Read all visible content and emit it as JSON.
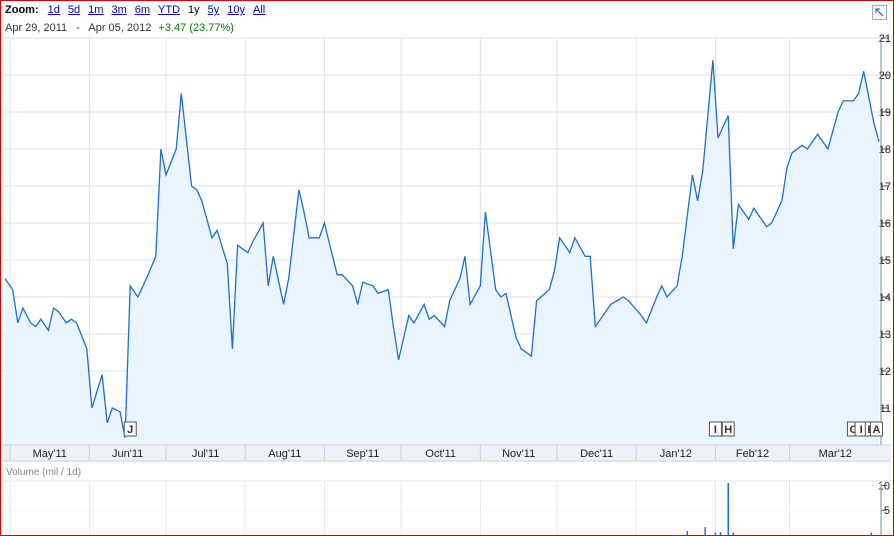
{
  "zoom": {
    "label": "Zoom:",
    "options": [
      "1d",
      "5d",
      "1m",
      "3m",
      "6m",
      "YTD",
      "1y",
      "5y",
      "10y",
      "All"
    ],
    "active": "1y"
  },
  "range": {
    "start": "Apr 29, 2011",
    "separator": "-",
    "end": "Apr 05, 2012",
    "change": "+3.47 (23.77%)"
  },
  "volume_label": "Volume (mil / 1d)",
  "colors": {
    "line": "#1c6fd1",
    "fill": "#e9f4fd",
    "grid": "#dde3ea",
    "change": "#008000",
    "frame": "#d40000"
  },
  "chart_data": [
    {
      "type": "area",
      "x": [
        "2011-04-29",
        "2011-05-02",
        "2011-05-04",
        "2011-05-06",
        "2011-05-09",
        "2011-05-11",
        "2011-05-13",
        "2011-05-16",
        "2011-05-18",
        "2011-05-20",
        "2011-05-23",
        "2011-05-25",
        "2011-05-27",
        "2011-05-31",
        "2011-06-02",
        "2011-06-06",
        "2011-06-08",
        "2011-06-10",
        "2011-06-13",
        "2011-06-15",
        "2011-06-17",
        "2011-06-20",
        "2011-06-22",
        "2011-06-24",
        "2011-06-27",
        "2011-06-29",
        "2011-07-01",
        "2011-07-05",
        "2011-07-07",
        "2011-07-11",
        "2011-07-13",
        "2011-07-15",
        "2011-07-19",
        "2011-07-21",
        "2011-07-25",
        "2011-07-27",
        "2011-07-29",
        "2011-08-02",
        "2011-08-04",
        "2011-08-08",
        "2011-08-10",
        "2011-08-12",
        "2011-08-16",
        "2011-08-18",
        "2011-08-22",
        "2011-08-24",
        "2011-08-26",
        "2011-08-30",
        "2011-09-01",
        "2011-09-06",
        "2011-09-08",
        "2011-09-12",
        "2011-09-14",
        "2011-09-16",
        "2011-09-20",
        "2011-09-22",
        "2011-09-26",
        "2011-09-28",
        "2011-09-30",
        "2011-10-04",
        "2011-10-06",
        "2011-10-10",
        "2011-10-12",
        "2011-10-14",
        "2011-10-18",
        "2011-10-20",
        "2011-10-24",
        "2011-10-26",
        "2011-10-28",
        "2011-11-01",
        "2011-11-03",
        "2011-11-07",
        "2011-11-09",
        "2011-11-11",
        "2011-11-15",
        "2011-11-17",
        "2011-11-21",
        "2011-11-23",
        "2011-11-28",
        "2011-11-30",
        "2011-12-02",
        "2011-12-06",
        "2011-12-08",
        "2011-12-12",
        "2011-12-14",
        "2011-12-16",
        "2011-12-20",
        "2011-12-22",
        "2011-12-27",
        "2011-12-29",
        "2012-01-03",
        "2012-01-05",
        "2012-01-09",
        "2012-01-11",
        "2012-01-13",
        "2012-01-17",
        "2012-01-19",
        "2012-01-23",
        "2012-01-25",
        "2012-01-27",
        "2012-01-31",
        "2012-02-02",
        "2012-02-06",
        "2012-02-08",
        "2012-02-10",
        "2012-02-14",
        "2012-02-16",
        "2012-02-21",
        "2012-02-23",
        "2012-02-27",
        "2012-02-29",
        "2012-03-02",
        "2012-03-06",
        "2012-03-08",
        "2012-03-12",
        "2012-03-14",
        "2012-03-16",
        "2012-03-20",
        "2012-03-22",
        "2012-03-26",
        "2012-03-28",
        "2012-03-30",
        "2012-04-03",
        "2012-04-05"
      ],
      "series": [
        {
          "values": [
            14.5,
            14.2,
            13.3,
            13.7,
            13.3,
            13.2,
            13.4,
            13.1,
            13.7,
            13.6,
            13.3,
            13.4,
            13.3,
            12.6,
            11.0,
            11.9,
            10.6,
            11.0,
            10.9,
            10.2,
            14.3,
            14.0,
            14.3,
            14.6,
            15.1,
            18.0,
            17.3,
            18.0,
            19.5,
            17.0,
            16.9,
            16.6,
            15.6,
            15.8,
            14.9,
            12.6,
            15.4,
            15.2,
            15.5,
            16.0,
            14.3,
            15.1,
            13.8,
            14.5,
            16.9,
            16.3,
            15.6,
            15.6,
            16.0,
            14.6,
            14.6,
            14.3,
            13.8,
            14.4,
            14.3,
            14.1,
            14.2,
            13.2,
            12.3,
            13.5,
            13.3,
            13.8,
            13.4,
            13.5,
            13.2,
            13.9,
            14.5,
            15.1,
            13.8,
            14.3,
            16.3,
            14.2,
            14.0,
            14.1,
            12.9,
            12.6,
            12.4,
            13.9,
            14.2,
            14.7,
            15.6,
            15.2,
            15.6,
            15.1,
            15.1,
            13.2,
            13.6,
            13.8,
            14.0,
            13.9,
            13.5,
            13.3,
            14.0,
            14.3,
            14.0,
            14.3,
            15.1,
            17.3,
            16.6,
            17.4,
            20.4,
            18.3,
            18.9,
            15.3,
            16.5,
            16.1,
            16.4,
            15.9,
            16.0,
            16.6,
            17.5,
            17.9,
            18.1,
            18.0,
            18.4,
            18.2,
            18.0,
            19.0,
            19.3,
            19.3,
            19.5,
            20.1,
            18.7,
            18.2
          ]
        }
      ],
      "y_ticks": [
        "11",
        "12",
        "13",
        "14",
        "15",
        "16",
        "17",
        "18",
        "19",
        "20",
        "21"
      ],
      "ylim": [
        10.0,
        21.0
      ],
      "x_tick_labels": [
        "May'11",
        "Jun'11",
        "Jul'11",
        "Aug'11",
        "Sep'11",
        "Oct'11",
        "Nov'11",
        "Dec'11",
        "Jan'12",
        "Feb'12",
        "Mar'12"
      ],
      "x_tick_dates": [
        "2011-05-01",
        "2011-06-01",
        "2011-07-01",
        "2011-08-01",
        "2011-09-01",
        "2011-10-01",
        "2011-11-01",
        "2011-12-01",
        "2012-01-01",
        "2012-02-01",
        "2012-03-01"
      ],
      "grid": true,
      "annotations": [
        {
          "label": "J",
          "date": "2011-06-17"
        },
        {
          "label": "I",
          "date": "2012-02-01"
        },
        {
          "label": "H",
          "date": "2012-02-06"
        },
        {
          "label": "C",
          "date": "2012-03-26"
        },
        {
          "label": "I",
          "date": "2012-03-29"
        },
        {
          "label": "B",
          "date": "2012-04-02"
        },
        {
          "label": "A",
          "date": "2012-04-04"
        }
      ]
    },
    {
      "type": "bar",
      "ylabel": "Volume (mil / 1d)",
      "y_ticks": [
        "5",
        "10"
      ],
      "ylim": [
        0,
        10.5
      ],
      "x": [
        "2012-01-21",
        "2012-01-28",
        "2012-02-01",
        "2012-02-03",
        "2012-02-06",
        "2012-02-08",
        "2012-04-02"
      ],
      "values": [
        0.8,
        1.6,
        0.5,
        0.6,
        11.0,
        0.5,
        0.5
      ]
    }
  ]
}
